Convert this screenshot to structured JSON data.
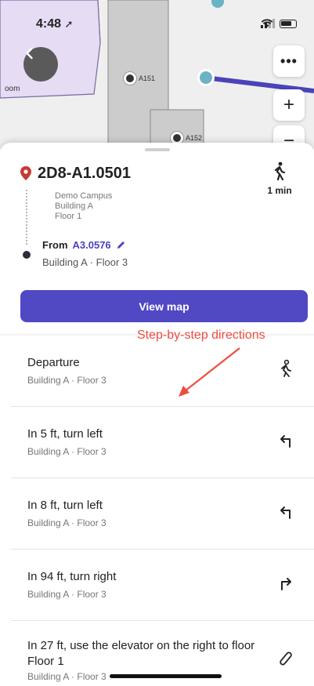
{
  "status_bar": {
    "time": "4:48",
    "location_glyph": "➚"
  },
  "map": {
    "room_labels": [
      "A151",
      "A152"
    ],
    "partial_label": "oom",
    "more_glyph": "•••",
    "zoom_in_glyph": "+",
    "zoom_out_glyph": "−",
    "colors": {
      "zone": "#e6dcf3",
      "building": "#cccccc",
      "route": "#4b43b9",
      "marker": "#6ab3c4"
    }
  },
  "destination": {
    "title": "2D8-A1.0501",
    "campus": "Demo Campus",
    "building": "Building A",
    "floor": "Floor 1",
    "walk_time": "1 min",
    "walk_icon": "walking-person-icon"
  },
  "origin": {
    "from_label": "From",
    "room": "A3.0576",
    "location": "Building A · Floor 3"
  },
  "view_map_label": "View map",
  "annotation_text": "Step-by-step directions",
  "steps": [
    {
      "title": "Departure",
      "location": "Building A · Floor 3",
      "icon": "departure-walker-icon",
      "glyph": "🚶"
    },
    {
      "title": "In 5 ft, turn left",
      "location": "Building A · Floor 3",
      "icon": "turn-left-icon",
      "glyph": "↰"
    },
    {
      "title": "In 8 ft, turn left",
      "location": "Building A · Floor 3",
      "icon": "turn-left-icon",
      "glyph": "↰"
    },
    {
      "title": "In 94 ft, turn right",
      "location": "Building A · Floor 3",
      "icon": "turn-right-icon",
      "glyph": "↱"
    },
    {
      "title": "In 27 ft, use the elevator on the right to floor Floor 1",
      "location": "Building A · Floor 3",
      "icon": "elevator-icon",
      "glyph": "⟋"
    }
  ],
  "colors": {
    "accent": "#5148c4",
    "pin": "#c53a32",
    "annotation": "#ee4b3f"
  }
}
